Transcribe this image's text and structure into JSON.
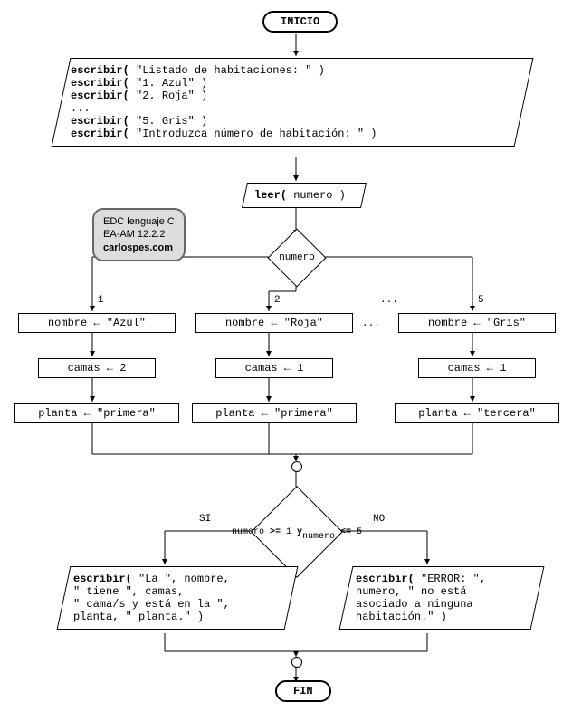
{
  "terminals": {
    "start": "INICIO",
    "end": "FIN"
  },
  "io1": {
    "l1a": "escribir(",
    "l1b": " \"Listado de habitaciones: \" )",
    "l2a": "escribir(",
    "l2b": " \"1. Azul\" )",
    "l3a": "escribir(",
    "l3b": " \"2. Roja\" )",
    "l4": "...",
    "l5a": "escribir(",
    "l5b": " \"5. Gris\" )",
    "l6a": "escribir(",
    "l6b": " \"Introduzca número de habitación: \" )"
  },
  "io2": {
    "a": "leer(",
    "b": " numero )"
  },
  "switch": {
    "var": "numero",
    "c1": "1",
    "c2": "2",
    "dots": "...",
    "c3": "5"
  },
  "b1": {
    "n": "nombre ← \"Azul\"",
    "c": "camas ← 2",
    "p": "planta ← \"primera\""
  },
  "b2": {
    "n": "nombre ← \"Roja\"",
    "c": "camas ← 1",
    "p": "planta ← \"primera\""
  },
  "b3": {
    "n": "nombre ← \"Gris\"",
    "c": "camas ← 1",
    "p": "planta ← \"tercera\""
  },
  "bdots": "...",
  "cond": {
    "text": "numero >= 1 y\nnumero <= 5",
    "yes": "SI",
    "no": "NO"
  },
  "outYes": {
    "a": "escribir(",
    "b": " \"La \", nombre,",
    "c": "\" tiene \", camas,",
    "d": "\" cama/s y está en la \",",
    "e": "planta, \" planta.\" )"
  },
  "outNo": {
    "a": "escribir(",
    "b": " \"ERROR: \",",
    "c": "numero, \" no está",
    "d": "asociado a ninguna",
    "e": "habitación.\" )"
  },
  "badge": {
    "l1": "EDC lenguaje C",
    "l2": "EA-AM 12.2.2",
    "l3": "carlospes.com"
  }
}
